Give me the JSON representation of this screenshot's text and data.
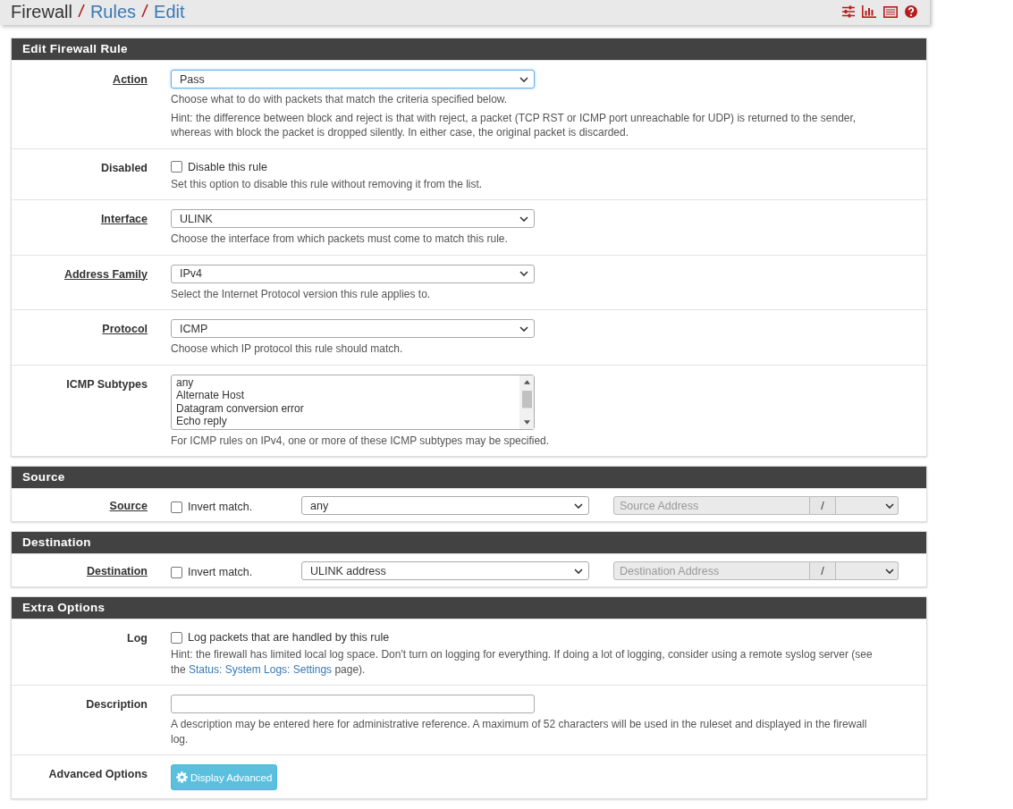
{
  "breadcrumb": [
    {
      "text": "Firewall",
      "link": false
    },
    {
      "text": "Rules",
      "link": true
    },
    {
      "text": "Edit",
      "link": true
    }
  ],
  "sections": [
    {
      "title": "Edit Firewall Rule",
      "rows": [
        {
          "kind": "select",
          "label": "Action",
          "label_link": true,
          "value": "Pass",
          "focused": true,
          "help": [
            "Choose what to do with packets that match the criteria specified below.",
            "Hint: the difference between block and reject is that with reject, a packet (TCP RST or ICMP port unreachable for UDP) is returned to the sender, whereas with block the packet is dropped silently. In either case, the original packet is discarded."
          ]
        },
        {
          "kind": "checkbox",
          "label": "Disabled",
          "label_link": false,
          "text": "Disable this rule",
          "checked": false,
          "help": [
            "Set this option to disable this rule without removing it from the list."
          ]
        },
        {
          "kind": "select",
          "label": "Interface",
          "label_link": true,
          "value": "ULINK",
          "focused": false,
          "help": [
            "Choose the interface from which packets must come to match this rule."
          ]
        },
        {
          "kind": "select",
          "label": "Address Family",
          "label_link": true,
          "value": "IPv4",
          "focused": false,
          "help": [
            "Select the Internet Protocol version this rule applies to."
          ]
        },
        {
          "kind": "select",
          "label": "Protocol",
          "label_link": true,
          "value": "ICMP",
          "focused": false,
          "help": [
            "Choose which IP protocol this rule should match."
          ]
        },
        {
          "kind": "listbox",
          "label": "ICMP Subtypes",
          "label_link": false,
          "options": [
            {
              "text": "any",
              "selected": false
            },
            {
              "text": "Alternate Host",
              "selected": false
            },
            {
              "text": "Datagram conversion error",
              "selected": false
            },
            {
              "text": "Echo reply",
              "selected": false
            }
          ],
          "help": [
            "For ICMP rules on IPv4, one or more of these ICMP subtypes may be specified."
          ]
        }
      ]
    },
    {
      "title": "Source",
      "rows": [
        {
          "kind": "address",
          "label": "Source",
          "label_link": true,
          "text": "Invert match.",
          "checked": false,
          "value": "any",
          "address_placeholder": "Source Address",
          "address_disabled": true,
          "separator": "/"
        }
      ]
    },
    {
      "title": "Destination",
      "rows": [
        {
          "kind": "address",
          "label": "Destination",
          "label_link": true,
          "text": "Invert match.",
          "checked": false,
          "value": "ULINK address",
          "address_placeholder": "Destination Address",
          "address_disabled": true,
          "separator": "/"
        }
      ]
    },
    {
      "title": "Extra Options",
      "rows": [
        {
          "kind": "checkbox",
          "label": "Log",
          "label_link": false,
          "text": "Log packets that are handled by this rule",
          "checked": false,
          "help": [
            {
              "before": "Hint: the firewall has limited local log space. Don't turn on logging for everything. If doing a lot of logging, consider using a remote syslog server (see the ",
              "link": "Status: System Logs: Settings",
              "after": " page)."
            }
          ]
        },
        {
          "kind": "input",
          "label": "Description",
          "label_link": false,
          "help": [
            "A description may be entered here for administrative reference. A maximum of 52 characters will be used in the ruleset and displayed in the firewall log."
          ]
        },
        {
          "kind": "button",
          "label": "Advanced Options",
          "label_link": false,
          "button_text": "Display Advanced"
        }
      ]
    }
  ]
}
